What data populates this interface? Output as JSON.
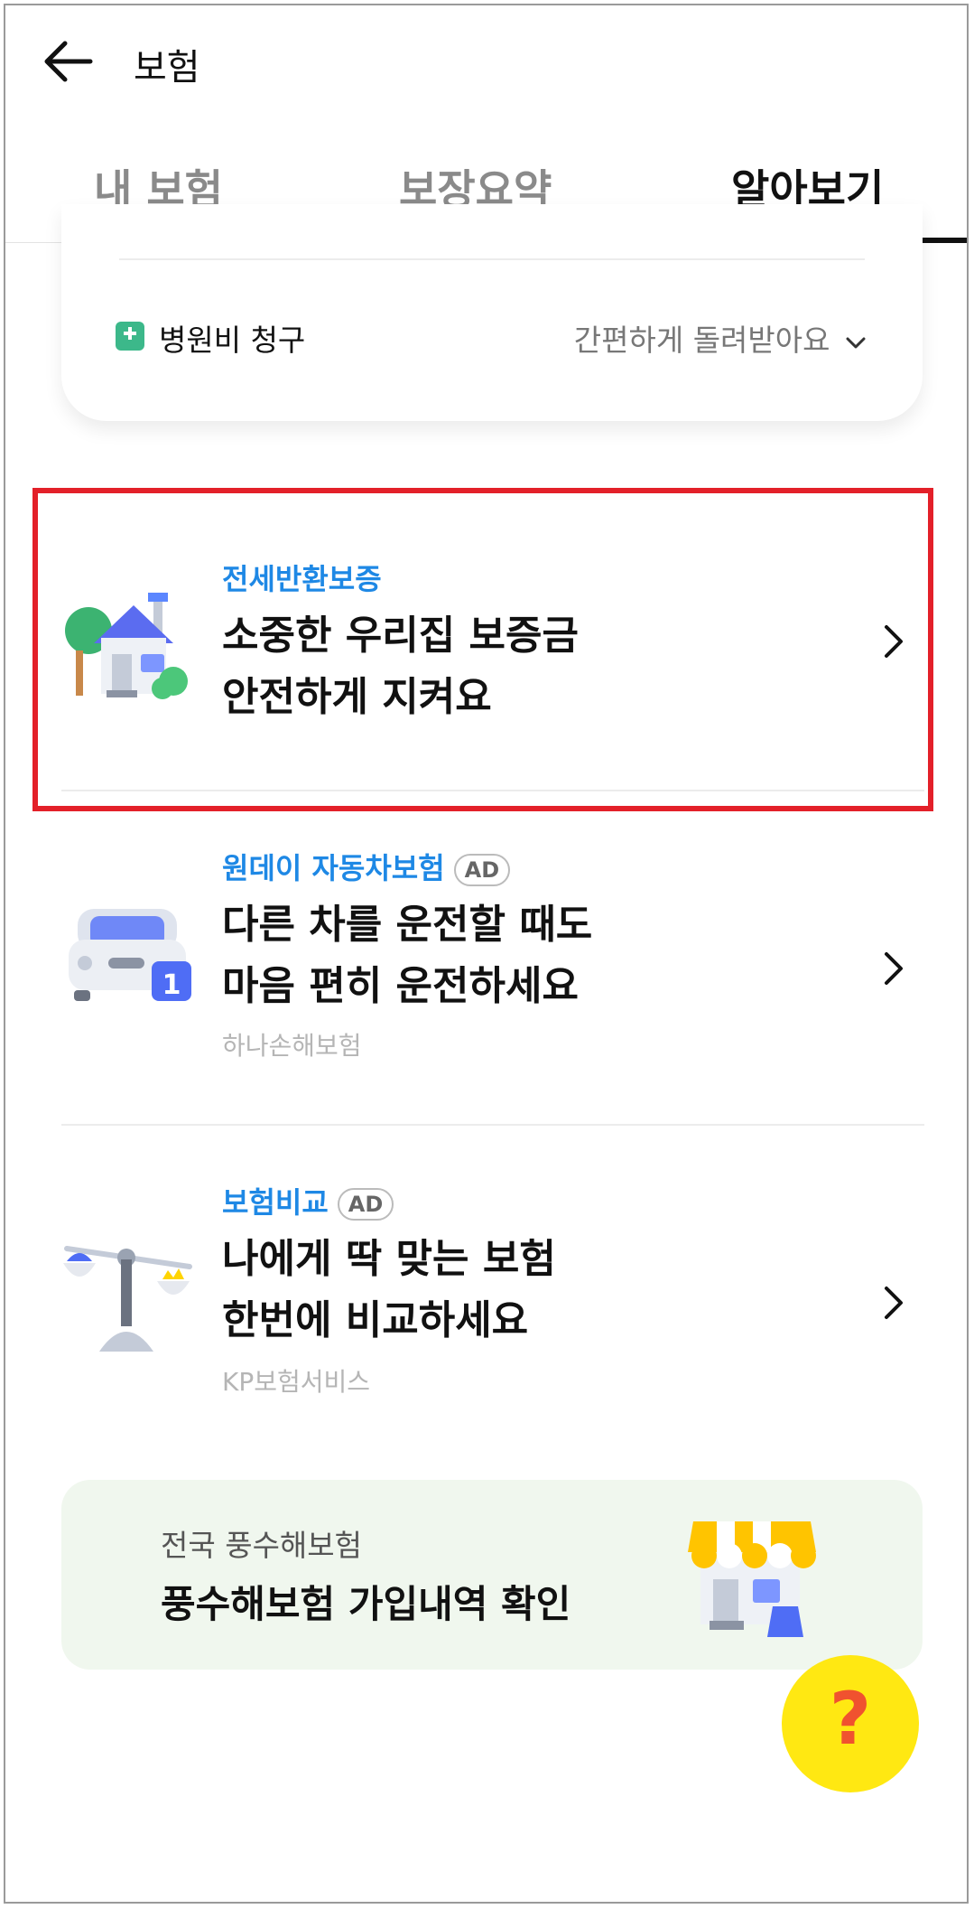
{
  "header": {
    "title": "보험"
  },
  "tabs": [
    {
      "label": "내 보험"
    },
    {
      "label": "보장요약"
    },
    {
      "label": "알아보기"
    }
  ],
  "active_tab": "알아보기",
  "claim": {
    "label": "병원비 청구",
    "right_text": "간편하게 돌려받아요"
  },
  "items": [
    {
      "eyebrow": "전세반환보증",
      "line1": "소중한 우리집 보증금",
      "line2": "안전하게 지켜요",
      "ad": "",
      "company": ""
    },
    {
      "eyebrow": "원데이 자동차보험",
      "line1": "다른 차를 운전할 때도",
      "line2": "마음 편히 운전하세요",
      "ad": "AD",
      "company": "하나손해보험",
      "calendar_day": "1"
    },
    {
      "eyebrow": "보험비교",
      "line1": "나에게 딱 맞는 보험",
      "line2": "한번에 비교하세요",
      "ad": "AD",
      "company": "KP보험서비스"
    }
  ],
  "banner": {
    "subtitle": "전국 풍수해보험",
    "title": "풍수해보험 가입내역 확인"
  },
  "help": {
    "symbol": "?"
  },
  "colors": {
    "accent": "#1e88e5",
    "highlight": "#e32029",
    "fab": "#ffe812"
  }
}
